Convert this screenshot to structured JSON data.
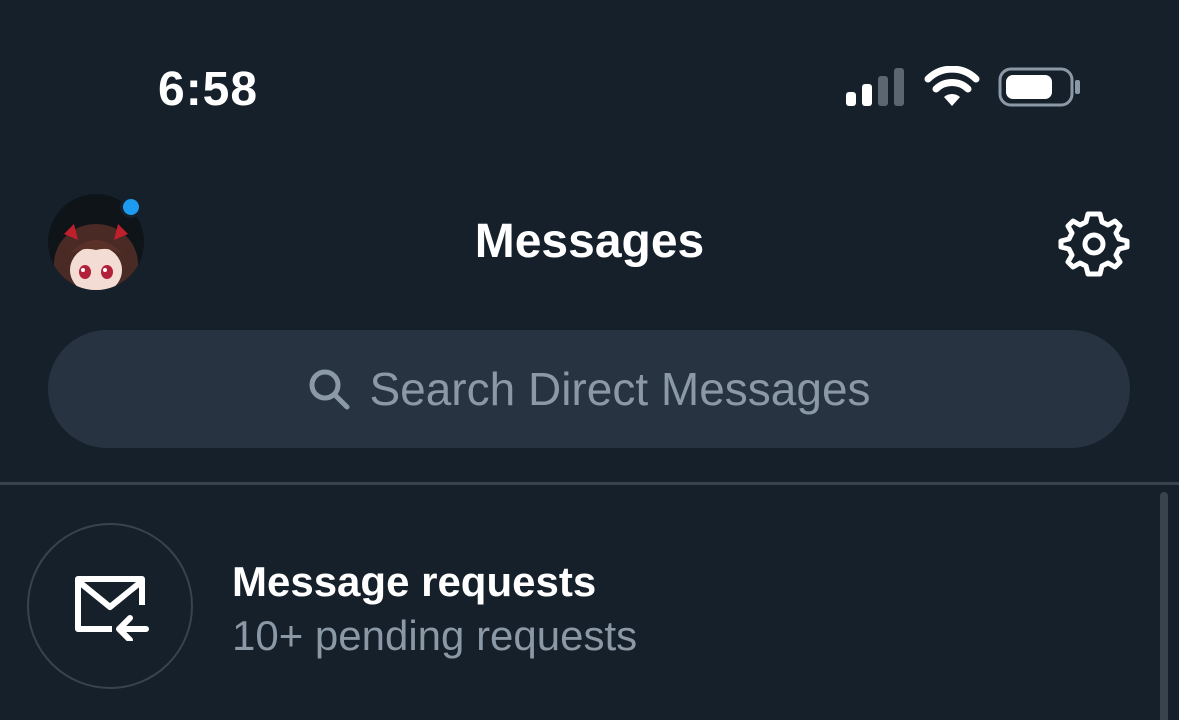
{
  "status_bar": {
    "time": "6:58",
    "icons": [
      "cellular-signal-icon",
      "wifi-icon",
      "battery-icon"
    ]
  },
  "header": {
    "title": "Messages",
    "avatar": "profile-avatar",
    "notification_dot_color": "#1d9bf0",
    "settings_icon": "gear-icon"
  },
  "search": {
    "icon": "search-icon",
    "placeholder": "Search Direct Messages"
  },
  "message_requests": {
    "icon": "mail-incoming-icon",
    "title": "Message requests",
    "subtitle": "10+ pending requests"
  },
  "colors": {
    "background": "#15202b",
    "search_bg": "#273340",
    "secondary_text": "#8b98a5",
    "divider": "#38444d",
    "accent": "#1d9bf0"
  }
}
